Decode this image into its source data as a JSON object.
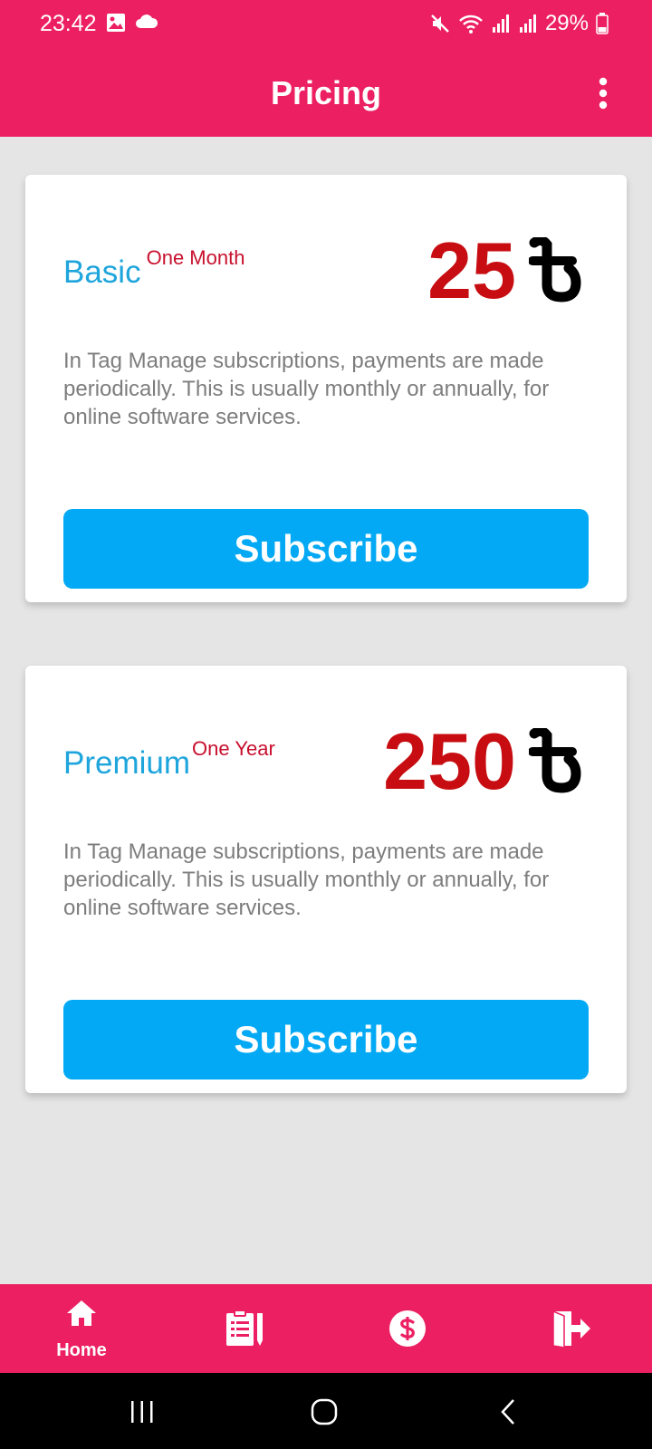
{
  "status_bar": {
    "time": "23:42",
    "battery": "29%",
    "icons": [
      "image-icon",
      "cloud-icon",
      "mute-icon",
      "wifi-icon",
      "signal-icon",
      "signal-icon",
      "battery-icon"
    ]
  },
  "app_bar": {
    "title": "Pricing",
    "menu_icon": "more-vert-icon"
  },
  "plans": [
    {
      "name": "Basic",
      "period": "One Month",
      "price": "25",
      "currency_icon": "taka-icon",
      "description": "In Tag Manage subscriptions, payments are made periodically. This is usually monthly or annually, for online software services.",
      "button_label": "Subscribe"
    },
    {
      "name": "Premium",
      "period": "One Year",
      "price": "250",
      "currency_icon": "taka-icon",
      "description": "In Tag Manage subscriptions, payments are made periodically. This is usually monthly or annually, for online software services.",
      "button_label": "Subscribe"
    }
  ],
  "bottom_nav": {
    "items": [
      {
        "icon": "home-icon",
        "label": "Home",
        "active": true
      },
      {
        "icon": "notes-icon",
        "label": ""
      },
      {
        "icon": "dollar-icon",
        "label": ""
      },
      {
        "icon": "logout-icon",
        "label": ""
      }
    ]
  },
  "system_nav": [
    "recents-icon",
    "home-circle-icon",
    "back-icon"
  ],
  "colors": {
    "primary": "#ec1f63",
    "plan_name": "#1ea5dc",
    "price": "#c70d11",
    "button": "#03a9f4",
    "background": "#e5e5e5"
  }
}
